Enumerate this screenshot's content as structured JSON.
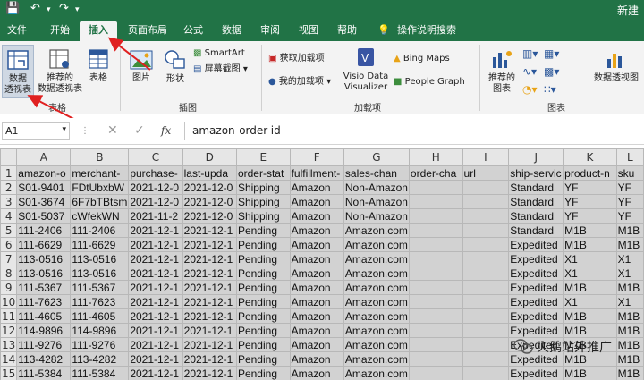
{
  "titlebar": {
    "doc_title": "新建"
  },
  "tabs": [
    "文件",
    "开始",
    "插入",
    "页面布局",
    "公式",
    "数据",
    "审阅",
    "视图",
    "帮助",
    "操作说明搜索"
  ],
  "ribbon": {
    "pivot_table": "数据\n透视表",
    "recommended_pivot": "推荐的\n数据透视表",
    "table": "表格",
    "table_group": "表格",
    "pictures": "图片",
    "shapes": "形状",
    "smartart": "SmartArt",
    "screenshot": "屏幕截图",
    "illustrations_group": "插图",
    "get_addins": "获取加载项",
    "my_addins": "我的加载项",
    "visio": "Visio Data\nVisualizer",
    "bing_maps": "Bing Maps",
    "people_graph": "People Graph",
    "addins_group": "加载项",
    "recommended_charts": "推荐的\n图表",
    "pivot_chart": "数据透视图",
    "charts_group": "图表"
  },
  "annotations": {
    "step2": "2"
  },
  "formula": {
    "namebox": "A1",
    "fx": "fx",
    "value": "amazon-order-id"
  },
  "columns": [
    "A",
    "B",
    "C",
    "D",
    "E",
    "F",
    "G",
    "H",
    "I",
    "J",
    "K",
    "L"
  ],
  "rows": [
    [
      "amazon-o",
      "merchant-",
      "purchase-",
      "last-upda",
      "order-stat",
      "fulfillment-",
      "sales-chan",
      "order-cha",
      "url",
      "ship-servic",
      "product-n",
      "sku"
    ],
    [
      "S01-9401",
      "FDtUbxbW",
      "2021-12-0",
      "2021-12-0",
      "Shipping",
      "Amazon",
      "Non-Amazon",
      "",
      "",
      "Standard",
      "YF",
      "YF"
    ],
    [
      "S01-3674",
      "6F7bTBtsm",
      "2021-12-0",
      "2021-12-0",
      "Shipping",
      "Amazon",
      "Non-Amazon",
      "",
      "",
      "Standard",
      "YF",
      "YF"
    ],
    [
      "S01-5037",
      "cWfekWN",
      "2021-11-2",
      "2021-12-0",
      "Shipping",
      "Amazon",
      "Non-Amazon",
      "",
      "",
      "Standard",
      "YF",
      "YF"
    ],
    [
      "111-2406",
      "111-2406",
      "2021-12-1",
      "2021-12-1",
      "Pending",
      "Amazon",
      "Amazon.com",
      "",
      "",
      "Standard",
      "M1B",
      "M1B"
    ],
    [
      "111-6629",
      "111-6629",
      "2021-12-1",
      "2021-12-1",
      "Pending",
      "Amazon",
      "Amazon.com",
      "",
      "",
      "Expedited",
      "M1B",
      "M1B"
    ],
    [
      "113-0516",
      "113-0516",
      "2021-12-1",
      "2021-12-1",
      "Pending",
      "Amazon",
      "Amazon.com",
      "",
      "",
      "Expedited",
      "X1",
      "X1"
    ],
    [
      "113-0516",
      "113-0516",
      "2021-12-1",
      "2021-12-1",
      "Pending",
      "Amazon",
      "Amazon.com",
      "",
      "",
      "Expedited",
      "X1",
      "X1"
    ],
    [
      "111-5367",
      "111-5367",
      "2021-12-1",
      "2021-12-1",
      "Pending",
      "Amazon",
      "Amazon.com",
      "",
      "",
      "Expedited",
      "M1B",
      "M1B"
    ],
    [
      "111-7623",
      "111-7623",
      "2021-12-1",
      "2021-12-1",
      "Pending",
      "Amazon",
      "Amazon.com",
      "",
      "",
      "Expedited",
      "X1",
      "X1"
    ],
    [
      "111-4605",
      "111-4605",
      "2021-12-1",
      "2021-12-1",
      "Pending",
      "Amazon",
      "Amazon.com",
      "",
      "",
      "Expedited",
      "M1B",
      "M1B"
    ],
    [
      "114-9896",
      "114-9896",
      "2021-12-1",
      "2021-12-1",
      "Pending",
      "Amazon",
      "Amazon.com",
      "",
      "",
      "Expedited",
      "M1B",
      "M1B"
    ],
    [
      "111-9276",
      "111-9276",
      "2021-12-1",
      "2021-12-1",
      "Pending",
      "Amazon",
      "Amazon.com",
      "",
      "",
      "Expedited",
      "M1B",
      "M1B"
    ],
    [
      "113-4282",
      "113-4282",
      "2021-12-1",
      "2021-12-1",
      "Pending",
      "Amazon",
      "Amazon.com",
      "",
      "",
      "Expedited",
      "M1B",
      "M1B"
    ],
    [
      "111-5384",
      "111-5384",
      "2021-12-1",
      "2021-12-1",
      "Pending",
      "Amazon",
      "Amazon.com",
      "",
      "",
      "Expedited",
      "M1B",
      "M1B"
    ]
  ],
  "watermark": "火鹅站外推广",
  "colors": {
    "excel_green": "#217346",
    "arrow_red": "#e02020"
  }
}
